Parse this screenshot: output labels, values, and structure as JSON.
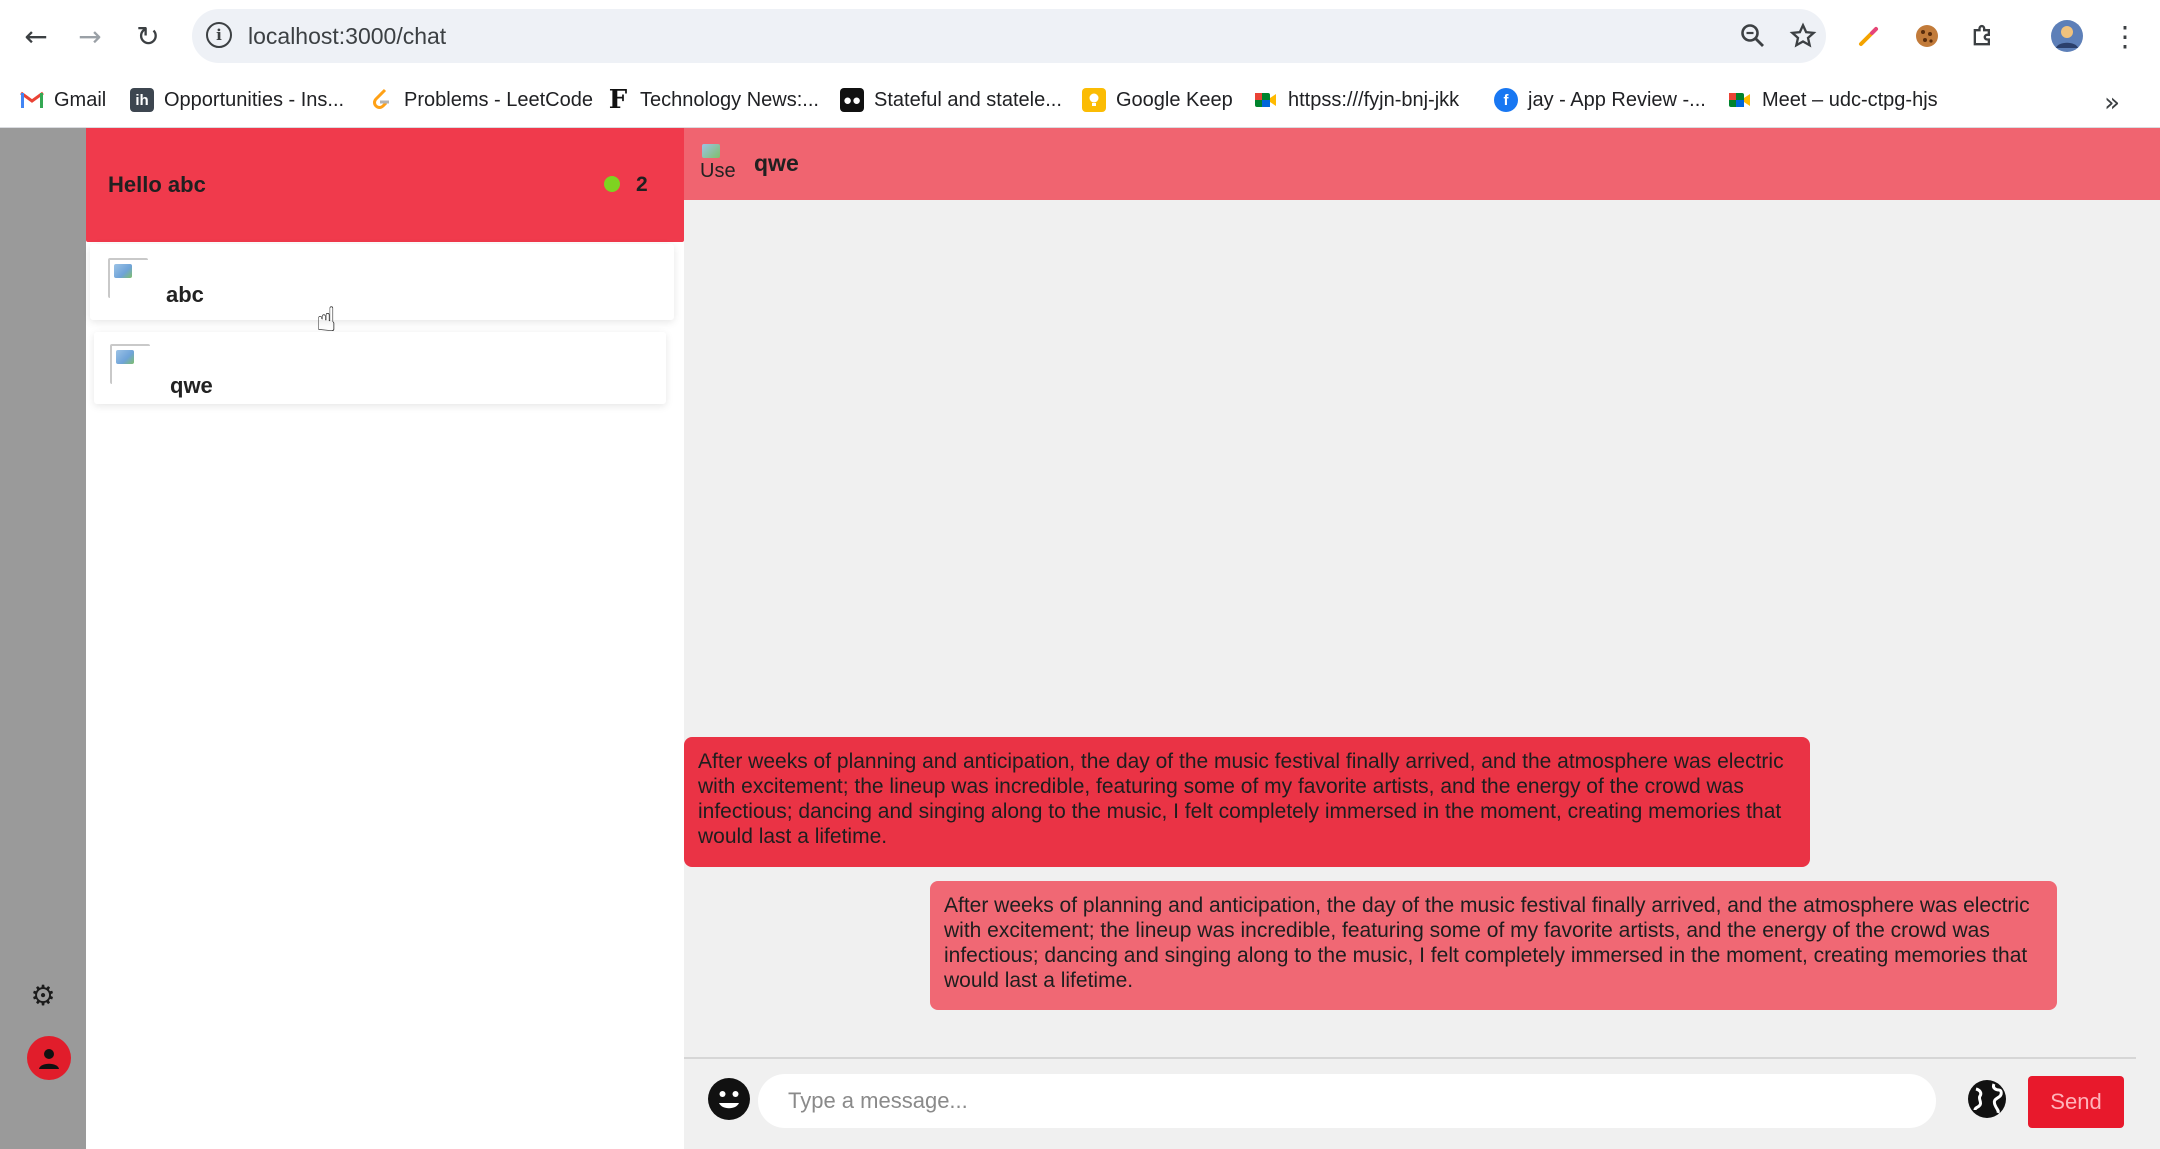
{
  "browser": {
    "url": "localhost:3000/chat",
    "icons": [
      "back-arrow-icon",
      "forward-arrow-icon",
      "reload-icon",
      "site-info-icon",
      "zoom-icon",
      "star-icon",
      "pen-icon",
      "cookie-icon",
      "puzzle-icon",
      "profile-icon",
      "kebab-menu-icon"
    ],
    "bookmarks": [
      {
        "label": "Gmail",
        "icon": "gmail-icon"
      },
      {
        "label": "Opportunities - Ins...",
        "icon": "internshala-icon"
      },
      {
        "label": "Problems - LeetCode",
        "icon": "leetcode-icon"
      },
      {
        "label": "Technology News:...",
        "icon": "fortune-icon"
      },
      {
        "label": "Stateful and statele...",
        "icon": "medium-icon"
      },
      {
        "label": "Google Keep",
        "icon": "keep-icon"
      },
      {
        "label": "httpss:///fyjn-bnj-jkk",
        "icon": "meet-icon"
      },
      {
        "label": "jay - App Review -...",
        "icon": "facebook-icon"
      },
      {
        "label": "Meet – udc-ctpg-hjs",
        "icon": "meet-icon"
      }
    ],
    "more_icon": "chevron-double-right-icon"
  },
  "sidebar": {
    "title": "Hello abc",
    "online_count": "2",
    "contacts": [
      {
        "name": "abc"
      },
      {
        "name": "qwe"
      }
    ]
  },
  "chat": {
    "name": "qwe",
    "avatar_alt": "Use",
    "messages": [
      {
        "type": "received",
        "text": "After weeks of planning and anticipation, the day of the music festival finally arrived, and the atmosphere was electric with excitement; the lineup was incredible, featuring some of my favorite artists, and the energy of the crowd was infectious; dancing and singing along to the music, I felt completely immersed in the moment, creating memories that would last a lifetime."
      },
      {
        "type": "sent",
        "text": "After weeks of planning and anticipation, the day of the music festival finally arrived, and the atmosphere was electric with excitement; the lineup was incredible, featuring some of my favorite artists, and the energy of the crowd was infectious; dancing and singing along to the music, I felt completely immersed in the moment, creating memories that would last a lifetime."
      }
    ],
    "input_placeholder": "Type a message...",
    "send_label": "Send"
  },
  "colors": {
    "accent": "#f03a4c",
    "header": "#f06470",
    "received_bubble": "#ea3345",
    "sent_bubble": "#f06874",
    "send_button": "#e8192c",
    "online": "#7ed321"
  }
}
